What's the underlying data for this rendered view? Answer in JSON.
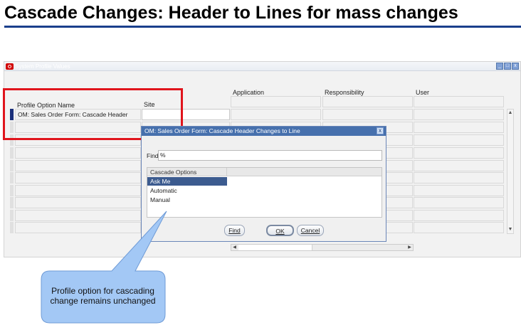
{
  "slide": {
    "title": "Cascade Changes: Header to Lines for mass changes"
  },
  "window": {
    "title": "System Profile Values",
    "controls": [
      "_",
      "□",
      "x"
    ],
    "columns": {
      "profile_option_name": "Profile Option Name",
      "site": "Site",
      "application": "Application",
      "responsibility": "Responsibility",
      "user": "User"
    },
    "rows": [
      {
        "profile_option_name": "OM: Sales Order Form: Cascade Header",
        "site": "",
        "application": "",
        "responsibility": "",
        "user": ""
      }
    ]
  },
  "dialog": {
    "title": "OM: Sales Order Form: Cascade Header Changes to Line",
    "close_glyph": "x",
    "find_label": "Find",
    "find_value": "%",
    "list_header": "Cascade Options",
    "options": [
      "Ask Me",
      "Automatic",
      "Manual"
    ],
    "selected_option": "Ask Me",
    "buttons": {
      "find": "Find",
      "ok": "OK",
      "cancel": "Cancel"
    }
  },
  "callout": {
    "text": "Profile option for cascading change remains unchanged"
  },
  "colors": {
    "title_rule": "#1a3f8c",
    "highlight": "#e0141c",
    "dialog_titlebar": "#4670ad",
    "selection": "#3c5b8f",
    "callout": "#a3c8f5"
  }
}
